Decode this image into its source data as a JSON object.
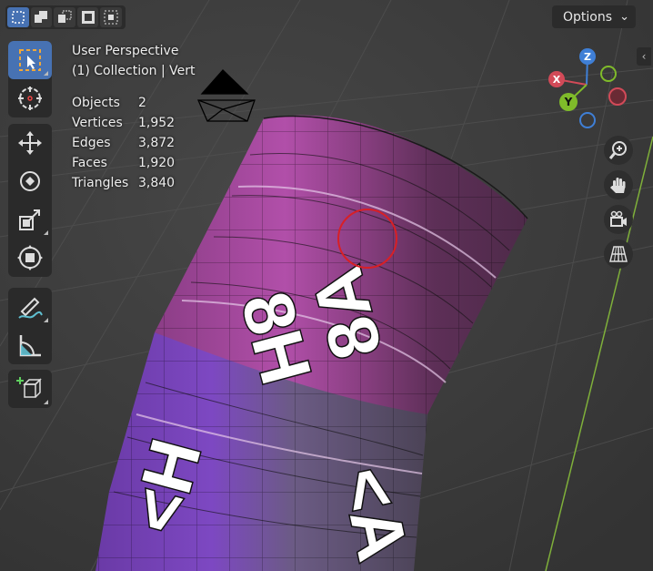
{
  "viewport": {
    "title": "User Perspective",
    "subtitle": "(1) Collection | Vert",
    "stats": [
      {
        "label": "Objects",
        "value": "2"
      },
      {
        "label": "Vertices",
        "value": "1,952"
      },
      {
        "label": "Edges",
        "value": "3,872"
      },
      {
        "label": "Faces",
        "value": "1,920"
      },
      {
        "label": "Triangles",
        "value": "3,840"
      }
    ]
  },
  "header": {
    "options_label": "Options",
    "options_arrow": "⌄",
    "collapse_arrow": "‹",
    "select_modes": [
      "select-new-icon",
      "select-extend-icon",
      "select-subtract-icon",
      "select-invert-icon",
      "select-intersect-icon"
    ]
  },
  "toolbar": {
    "tools": [
      "select-box-icon",
      "cursor-icon",
      "move-icon",
      "rotate-icon",
      "scale-icon",
      "transform-icon",
      "annotate-icon",
      "measure-icon",
      "add-cube-icon"
    ]
  },
  "gizmo": {
    "x_label": "X",
    "y_label": "Y",
    "z_label": "Z",
    "x_color": "#d24a58",
    "y_color": "#7fbb2a",
    "z_color": "#3f7fd6"
  },
  "texture_text": {
    "a1": "8H",
    "a2": "8A",
    "b1": "<H",
    "b2": "<A"
  },
  "colors": {
    "active_tool": "#4772b3",
    "background": "#3d3d3d",
    "cursor_ring": "#d81f26"
  }
}
